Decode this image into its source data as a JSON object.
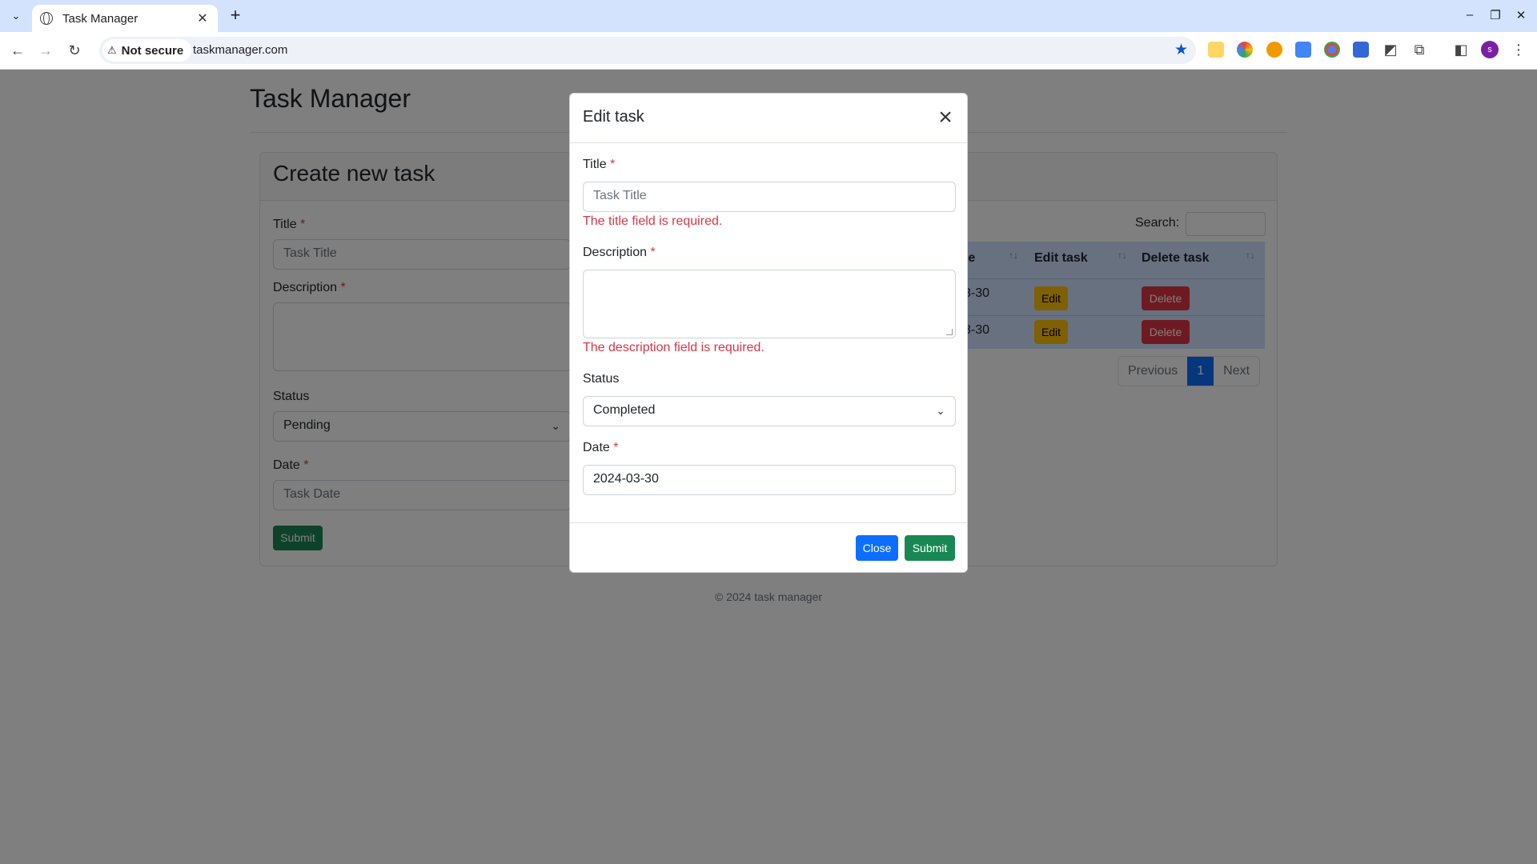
{
  "browser": {
    "tab_title": "Task Manager",
    "new_tab": "+",
    "security_label": "Not secure",
    "url": "taskmanager.com",
    "profile_initial": "s"
  },
  "app": {
    "title": "Task Manager",
    "footer": "© 2024 task manager"
  },
  "create_form": {
    "heading": "Create new task",
    "title_label": "Title",
    "title_placeholder": "Task Title",
    "description_label": "Description",
    "status_label": "Status",
    "status_value": "Pending",
    "date_label": "Date",
    "date_placeholder": "Task Date",
    "submit_label": "Submit",
    "required_mark": "*"
  },
  "task_table": {
    "search_label": "Search:",
    "columns": [
      "te",
      "Edit task",
      "Delete task"
    ],
    "rows": [
      {
        "date_fragment": "3-30",
        "edit": "Edit",
        "delete": "Delete"
      },
      {
        "date_fragment": "3-30",
        "edit": "Edit",
        "delete": "Delete"
      }
    ],
    "pagination": {
      "previous": "Previous",
      "current": "1",
      "next": "Next"
    }
  },
  "edit_modal": {
    "title": "Edit task",
    "title_label": "Title",
    "title_placeholder": "Task Title",
    "title_error": "The title field is required.",
    "description_label": "Description",
    "description_error": "The description field is required.",
    "status_label": "Status",
    "status_value": "Completed",
    "date_label": "Date",
    "date_value": "2024-03-30",
    "close_label": "Close",
    "submit_label": "Submit",
    "required_mark": "*"
  },
  "colors": {
    "primary": "#0d6efd",
    "success": "#198754",
    "warning": "#ffc107",
    "danger": "#dc3545",
    "table_row": "#cfe2ff",
    "backdrop": "rgba(0,0,0,0.5)"
  },
  "icons": {
    "tab_search": "chevron-down-icon",
    "back": "arrow-left-icon",
    "forward": "arrow-right-icon",
    "reload": "reload-icon",
    "bookmark": "star-icon",
    "close": "close-icon",
    "select_caret": "chevron-down-icon"
  }
}
